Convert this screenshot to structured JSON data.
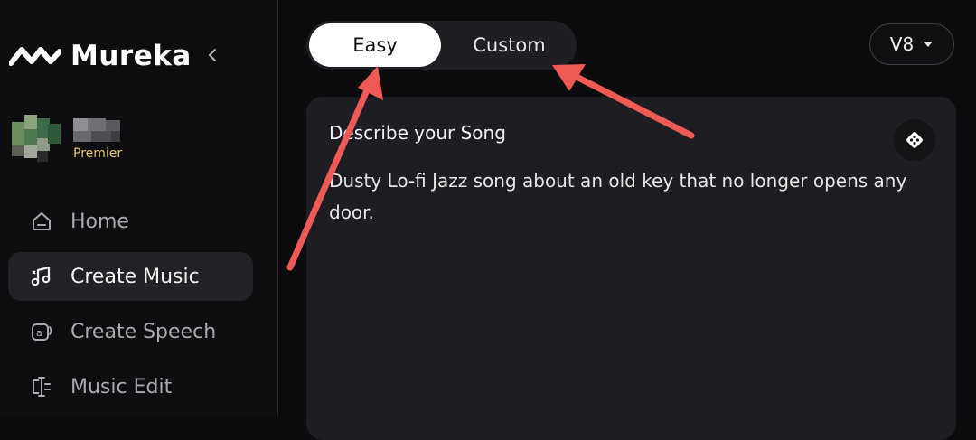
{
  "app": {
    "name": "Mureka"
  },
  "sidebar": {
    "user": {
      "plan": "Premier"
    },
    "items": [
      {
        "label": "Home",
        "icon": "home-icon",
        "active": false
      },
      {
        "label": "Create Music",
        "icon": "music-note-icon",
        "active": true
      },
      {
        "label": "Create Speech",
        "icon": "speech-icon",
        "active": false
      },
      {
        "label": "Music Edit",
        "icon": "edit-icon",
        "active": false
      }
    ]
  },
  "main": {
    "mode_tabs": [
      {
        "label": "Easy",
        "selected": true
      },
      {
        "label": "Custom",
        "selected": false
      }
    ],
    "model": {
      "selected": "V8"
    },
    "prompt": {
      "title": "Describe your Song",
      "text": "Dusty Lo-fi Jazz song about an old key that no longer opens any door."
    }
  },
  "colors": {
    "background": "#0c0c0e",
    "sidebar_active": "#222226",
    "card": "#1e1e22",
    "plan_badge": "#e8c873",
    "annotation_arrow": "#ee5a56"
  }
}
